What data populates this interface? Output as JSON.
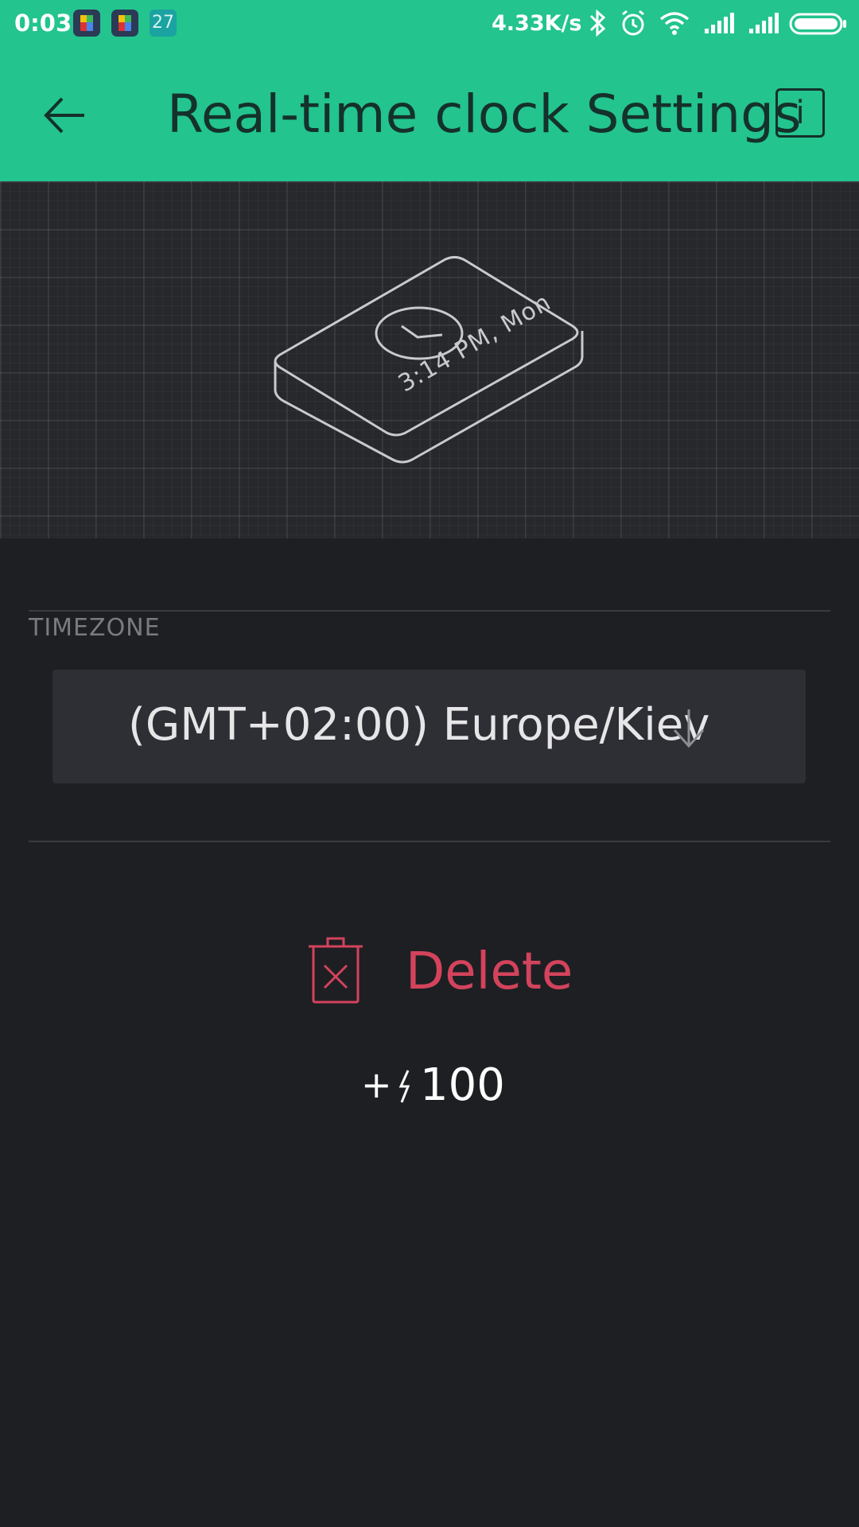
{
  "status_bar": {
    "time": "0:03",
    "notification_count": "27",
    "net_speed": "4.33K/s",
    "icons": [
      "app-icon",
      "app-icon",
      "bluetooth-icon",
      "alarm-icon",
      "wifi-icon",
      "signal-icon",
      "signal-icon",
      "battery-icon"
    ]
  },
  "app_bar": {
    "title": "Real-time clock Settings",
    "info_label": "i",
    "color": "#23c48e"
  },
  "illustration": {
    "device_display": "3:14 PM, Mon"
  },
  "timezone": {
    "label": "TIMEZONE",
    "value": "(GMT+02:00) Europe/Kiev"
  },
  "delete": {
    "label": "Delete",
    "color": "#d3435c"
  },
  "energy": {
    "prefix": "+",
    "value": "100"
  }
}
